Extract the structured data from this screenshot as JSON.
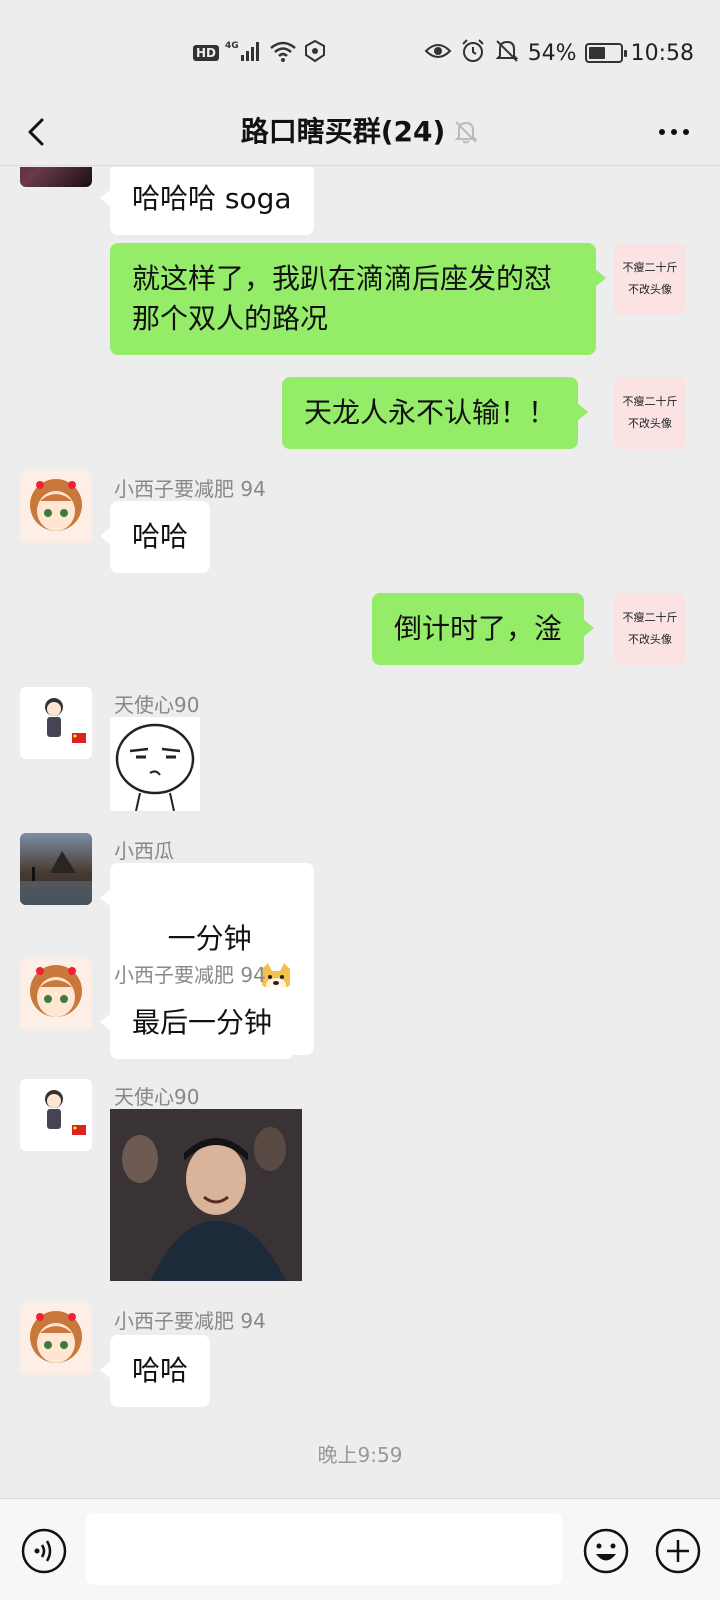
{
  "status_bar": {
    "hd": "HD",
    "network": "4G",
    "battery_pct": "54%",
    "battery_level": 0.54,
    "time": "10:58"
  },
  "nav": {
    "title": "路口瞎买群(24)"
  },
  "messages": [
    {
      "side": "left",
      "text": "哈哈哈 soga"
    },
    {
      "side": "right",
      "text": "就这样了，我趴在滴滴后座发的怼\n那个双人的路况"
    },
    {
      "side": "right",
      "text": "天龙人永不认输！！"
    },
    {
      "side": "left",
      "sender": "小西子要减肥  94",
      "text": "哈哈"
    },
    {
      "side": "right",
      "text": "倒计时了，淦"
    },
    {
      "side": "left",
      "sender": "天使心90",
      "kind": "sticker"
    },
    {
      "side": "left",
      "sender": "小西瓜",
      "text": "一分钟",
      "emoji": "doge"
    },
    {
      "side": "left",
      "sender": "小西子要减肥  94",
      "text": "最后一分钟"
    },
    {
      "side": "left",
      "sender": "天使心90",
      "kind": "photo"
    },
    {
      "side": "left",
      "sender": "小西子要减肥  94",
      "text": "哈哈"
    }
  ],
  "self_avatar": {
    "line1": "不瘦二十斤",
    "line2": "不改头像"
  },
  "timestamp": "晚上9:59",
  "icons": {
    "back": "chevron-left-icon",
    "mute": "bell-off-icon",
    "more": "more-dots-icon",
    "voice": "voice-icon",
    "emoji": "emoji-icon",
    "plus": "plus-circle-icon"
  }
}
